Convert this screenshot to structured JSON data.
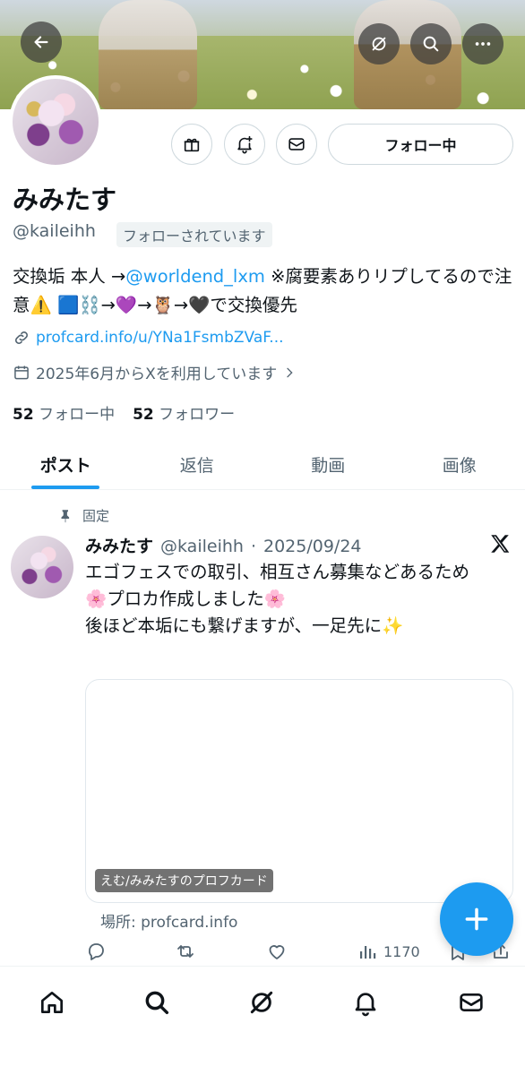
{
  "header": {
    "back_icon": "arrow-left-icon",
    "grok_icon": "grok-icon",
    "search_icon": "search-icon",
    "more_icon": "more-icon"
  },
  "profile": {
    "display_name": "みみたす",
    "handle": "@kaileihh",
    "follows_you": "フォローされています",
    "follow_button": "フォロー中",
    "bio_prefix": "交換垢 本人 →",
    "bio_mention": "@worldend_lxm",
    "bio_suffix": " ※腐要素ありリプしてるので注意⚠️ 🟦⛓️→💜→🦉→🖤で交換優先",
    "link": "profcard.info/u/YNa1FsmbZVaF...",
    "joined": "2025年6月からXを利用しています",
    "following_count": "52",
    "following_label": "フォロー中",
    "followers_count": "52",
    "followers_label": "フォロワー"
  },
  "tabs": [
    {
      "label": "ポスト",
      "active": true
    },
    {
      "label": "返信",
      "active": false
    },
    {
      "label": "動画",
      "active": false
    },
    {
      "label": "画像",
      "active": false
    }
  ],
  "post": {
    "pinned_label": "固定",
    "author_name": "みみたす",
    "author_handle": "@kaileihh",
    "separator": "·",
    "date": "2025/09/24",
    "lines": [
      "エゴフェスでの取引、相互さん募集などあるため",
      "🌸プロカ作成しました🌸",
      "後ほど本垢にも繋げますが、一足先に✨"
    ],
    "card_label": "えむ/みみたすのプロフカード",
    "card_source": "場所: profcard.info",
    "views": "1170"
  },
  "colors": {
    "accent": "#1d9bf0",
    "text": "#0f1419",
    "muted": "#536471"
  }
}
